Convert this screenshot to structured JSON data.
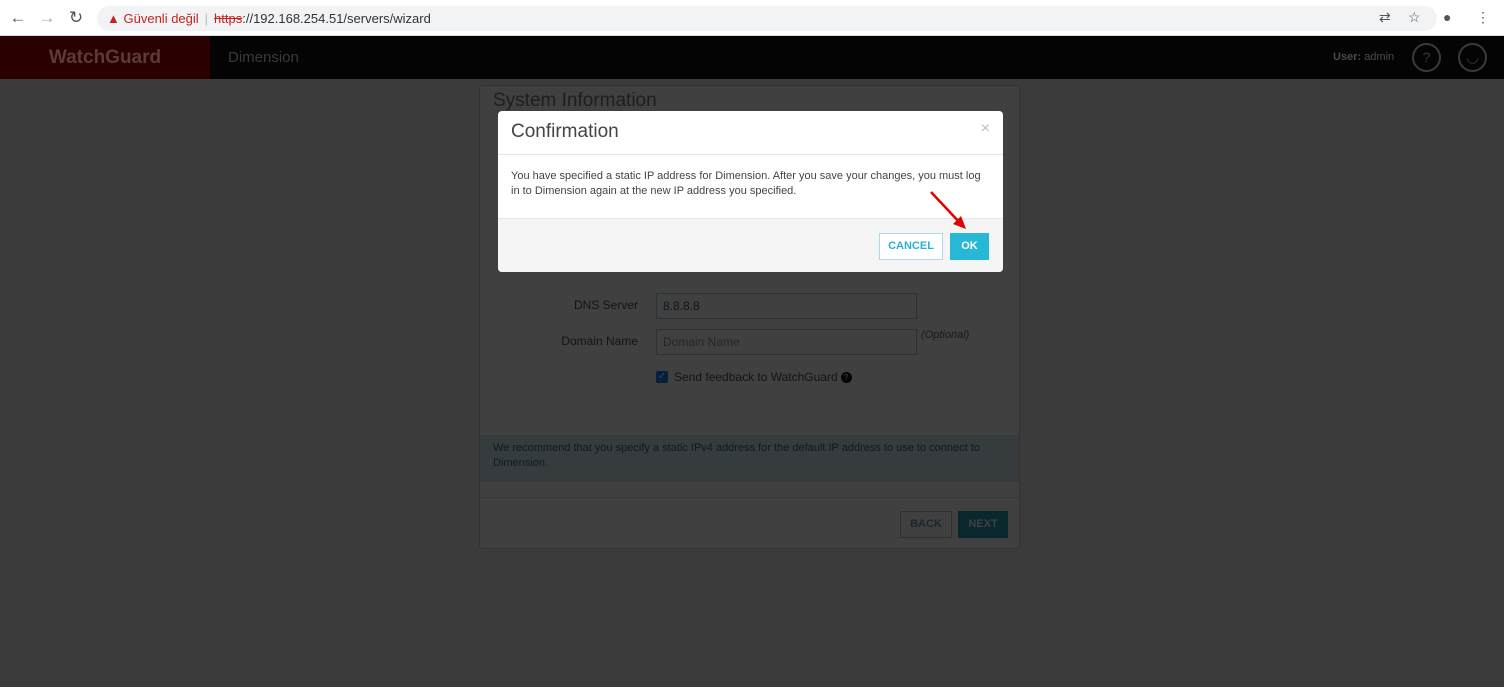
{
  "browser": {
    "security_label": "Güvenli değil",
    "url_scheme": "https",
    "url_rest": "://192.168.254.51/servers/wizard"
  },
  "app": {
    "logo": "WatchGuard",
    "product": "Dimension",
    "user_label": "User:",
    "user_name": "admin"
  },
  "panel": {
    "title": "System Information",
    "fields": [
      {
        "label": "DNS Server",
        "value": "8.8.8.8"
      },
      {
        "label": "Domain Name",
        "placeholder": "Domain Name",
        "hint": "(Optional)"
      }
    ],
    "feedback_label": "Send feedback to WatchGuard",
    "feedback_checked": true,
    "info": "We recommend that you specify a static IPv4 address for the default IP address to use to connect to Dimension.",
    "back": "BACK",
    "next": "NEXT"
  },
  "modal": {
    "title": "Confirmation",
    "close": "×",
    "message": "You have specified a static IP address for Dimension. After you save your changes, you must log in to Dimension again at the new IP address you specified.",
    "cancel": "CANCEL",
    "ok": "OK"
  },
  "colors": {
    "accent": "#27b8d8",
    "annotation": "#e00000"
  }
}
